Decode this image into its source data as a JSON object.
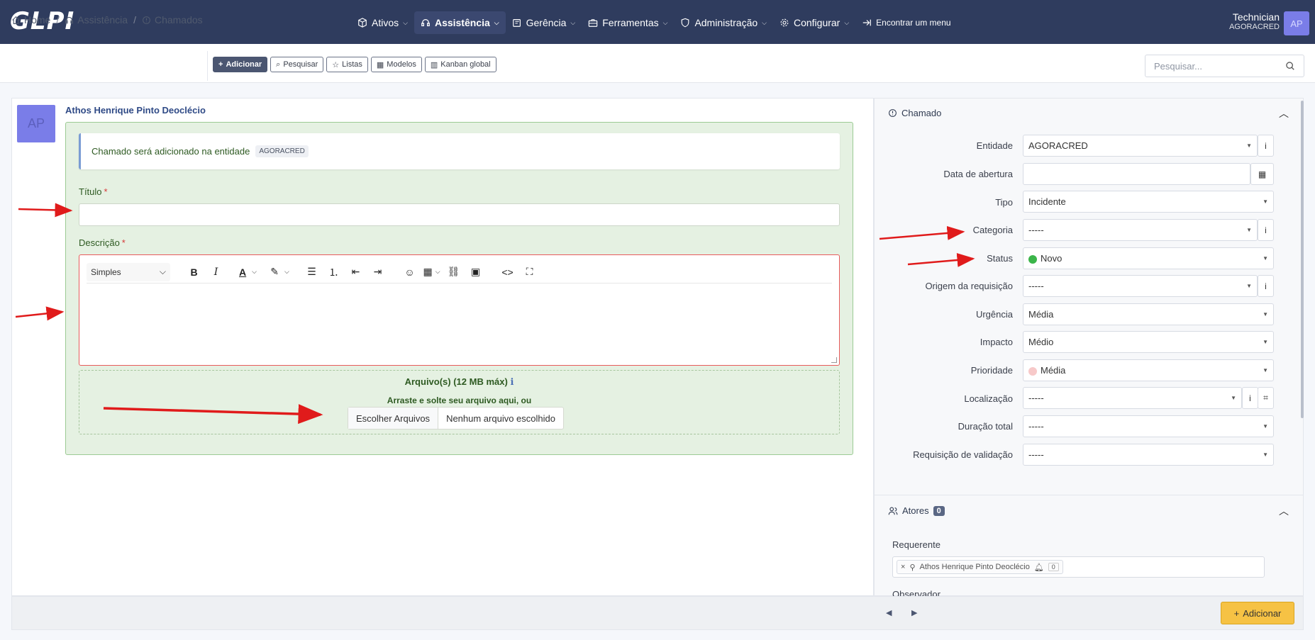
{
  "app": {
    "logo": "GLPI"
  },
  "nav": {
    "items": [
      {
        "label": "Ativos",
        "icon": "cube-icon"
      },
      {
        "label": "Assistência",
        "icon": "headset-icon",
        "active": true
      },
      {
        "label": "Gerência",
        "icon": "wallet-icon"
      },
      {
        "label": "Ferramentas",
        "icon": "briefcase-icon"
      },
      {
        "label": "Administração",
        "icon": "shield-icon"
      },
      {
        "label": "Configurar",
        "icon": "gear-icon"
      }
    ],
    "find_menu": "Encontrar um menu"
  },
  "user": {
    "name": "Technician",
    "entity": "AGORACRED",
    "initials": "AP"
  },
  "breadcrumb": {
    "home": "Home",
    "section": "Assistência",
    "page": "Chamados"
  },
  "actions": {
    "add": "Adicionar",
    "search": "Pesquisar",
    "lists": "Listas",
    "templates": "Modelos",
    "kanban": "Kanban global"
  },
  "search": {
    "placeholder": "Pesquisar..."
  },
  "form": {
    "author_initials": "AP",
    "author": "Athos Henrique Pinto Deoclécio",
    "notice": "Chamado será adicionado na entidade",
    "notice_entity": "AGORACRED",
    "title_label": "Título",
    "description_label": "Descrição",
    "required_mark": "*",
    "editor_format": "Simples",
    "files_title": "Arquivo(s) (12 MB máx)",
    "files_drop": "Arraste e solte seu arquivo aqui, ou",
    "choose_files": "Escolher Arquivos",
    "no_file": "Nenhum arquivo escolhido"
  },
  "ticket": {
    "header": "Chamado",
    "fields": [
      {
        "label": "Entidade",
        "value": "AGORACRED"
      },
      {
        "label": "Data de abertura",
        "value": ""
      },
      {
        "label": "Tipo",
        "value": "Incidente"
      },
      {
        "label": "Categoria",
        "value": "-----"
      },
      {
        "label": "Status",
        "value": "Novo",
        "dot_color": "#3bb54a"
      },
      {
        "label": "Origem da requisição",
        "value": "-----"
      },
      {
        "label": "Urgência",
        "value": "Média"
      },
      {
        "label": "Impacto",
        "value": "Médio"
      },
      {
        "label": "Prioridade",
        "value": "Média",
        "dot_color": "#f7c9c9"
      },
      {
        "label": "Localização",
        "value": "-----"
      },
      {
        "label": "Duração total",
        "value": "-----"
      },
      {
        "label": "Requisição de validação",
        "value": "-----"
      }
    ]
  },
  "actors": {
    "header": "Atores",
    "count": "0",
    "requester_label": "Requerente",
    "requester_name": "Athos Henrique Pinto Deoclécio",
    "requester_count": "0",
    "observer_label": "Observador"
  },
  "footer": {
    "add": "Adicionar"
  },
  "colors": {
    "navbar": "#2f3c5e",
    "accent_add": "#f6c244",
    "annotation_arrow": "#e01b1b"
  }
}
